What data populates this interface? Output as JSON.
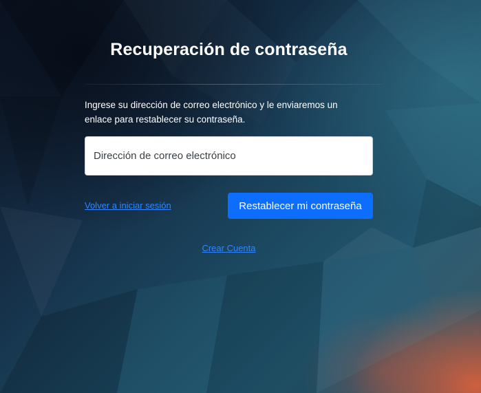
{
  "page": {
    "title": "Recuperación de contraseña",
    "instructions": "Ingrese su dirección de correo electrónico y le enviaremos un enlace para restablecer su contraseña."
  },
  "form": {
    "email_placeholder": "Dirección de correo electrónico",
    "email_value": "",
    "back_link_label": "Volver a iniciar sesión",
    "submit_label": "Restablecer mi contraseña"
  },
  "footer": {
    "create_account_label": "Crear Cuenta"
  },
  "colors": {
    "accent": "#0d6efd",
    "link": "#2f86ff",
    "background_dark": "#14283a",
    "background_highlight": "#d6603e"
  }
}
